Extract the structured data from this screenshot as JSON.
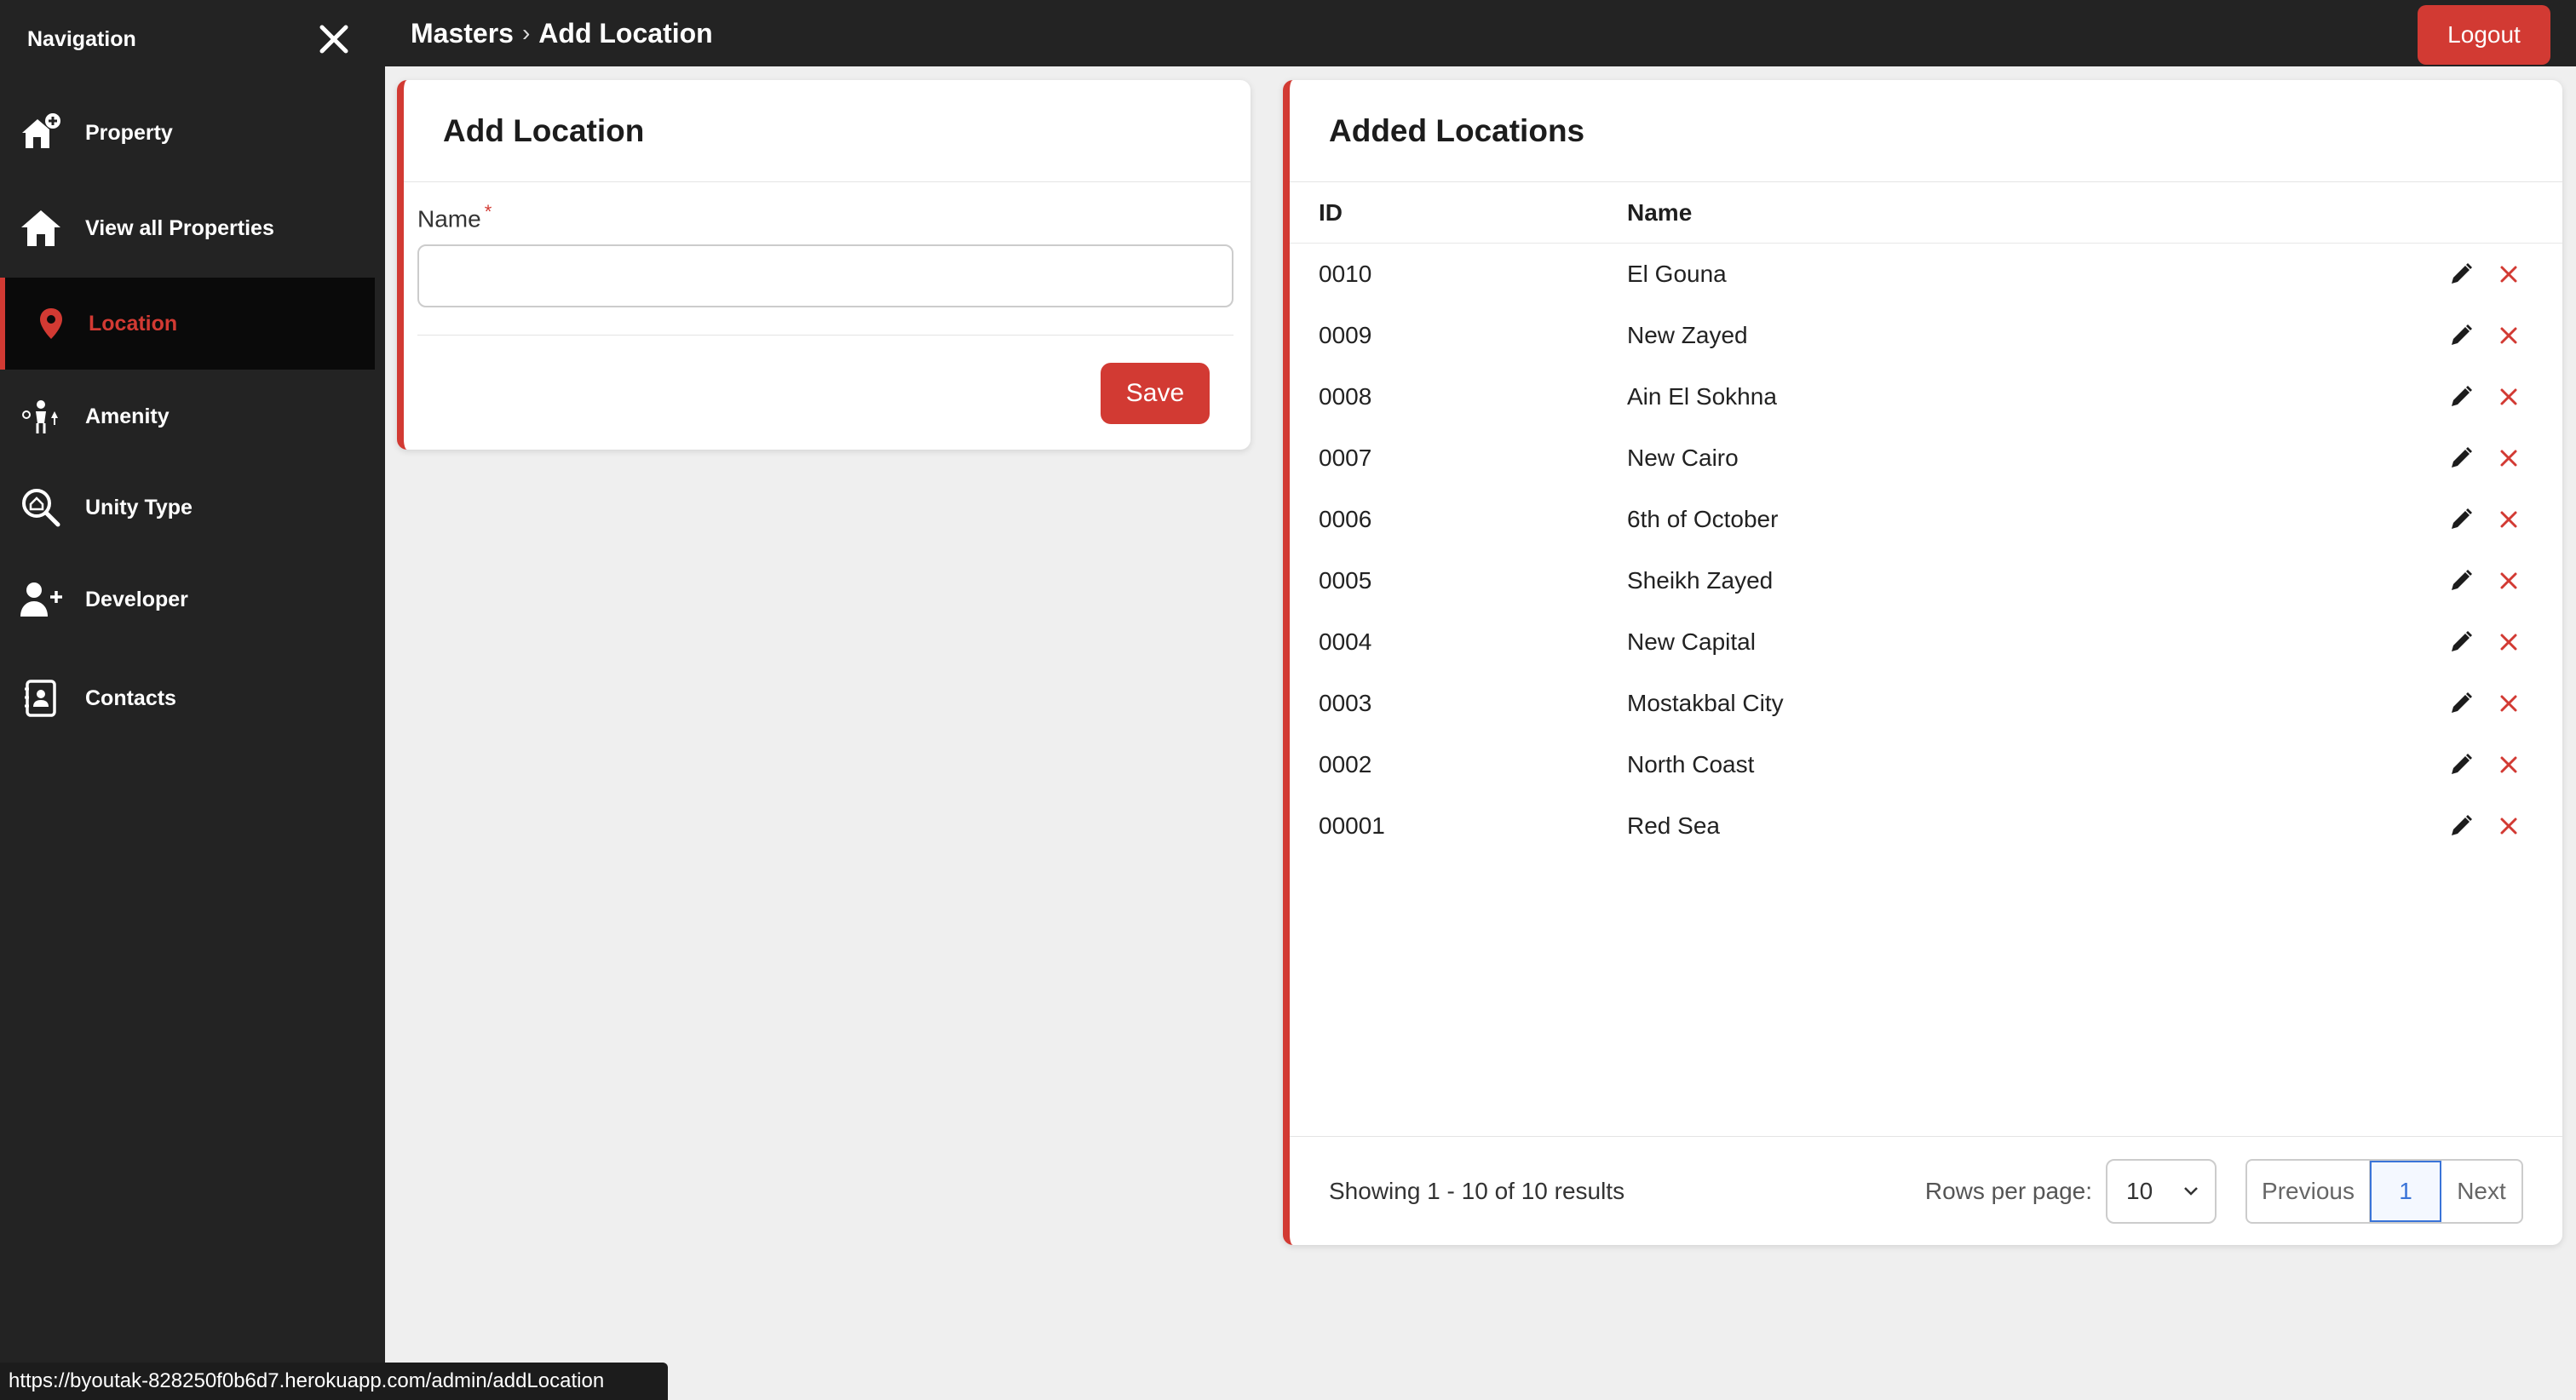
{
  "sidebar": {
    "title": "Navigation",
    "items": [
      {
        "label": "Property",
        "icon": "home-add-icon"
      },
      {
        "label": "View all Properties",
        "icon": "home-icon"
      },
      {
        "label": "Location",
        "icon": "map-pin-icon"
      },
      {
        "label": "Amenity",
        "icon": "amenity-icon"
      },
      {
        "label": "Unity Type",
        "icon": "search-home-icon"
      },
      {
        "label": "Developer",
        "icon": "user-add-icon"
      },
      {
        "label": "Contacts",
        "icon": "contacts-icon"
      }
    ],
    "active": "Location"
  },
  "header": {
    "breadcrumb_parent": "Masters",
    "breadcrumb_separator": "›",
    "breadcrumb_current": "Add Location",
    "logout_label": "Logout"
  },
  "add_form": {
    "title": "Add Location",
    "name_label": "Name",
    "required_marker": "*",
    "name_value": "",
    "save_label": "Save"
  },
  "locations": {
    "title": "Added Locations",
    "columns": {
      "id": "ID",
      "name": "Name"
    },
    "rows": [
      {
        "id": "0010",
        "name": "El Gouna"
      },
      {
        "id": "0009",
        "name": "New Zayed"
      },
      {
        "id": "0008",
        "name": "Ain El Sokhna"
      },
      {
        "id": "0007",
        "name": "New Cairo"
      },
      {
        "id": "0006",
        "name": "6th of October"
      },
      {
        "id": "0005",
        "name": "Sheikh Zayed"
      },
      {
        "id": "0004",
        "name": "New Capital"
      },
      {
        "id": "0003",
        "name": "Mostakbal City"
      },
      {
        "id": "0002",
        "name": "North Coast"
      },
      {
        "id": "00001",
        "name": "Red Sea"
      }
    ],
    "footer": {
      "showing_text": "Showing 1 - 10 of 10 results",
      "rows_per_page_label": "Rows per page:",
      "rows_per_page_value": "10",
      "previous_label": "Previous",
      "current_page": "1",
      "next_label": "Next"
    }
  },
  "status_bar": {
    "url": "https://byoutak-828250f0b6d7.herokuapp.com/admin/addLocation"
  },
  "colors": {
    "accent": "#d23a33",
    "sidebar_bg": "#232323",
    "page_bg": "#efefef",
    "pager_active": "#3a74d8"
  }
}
